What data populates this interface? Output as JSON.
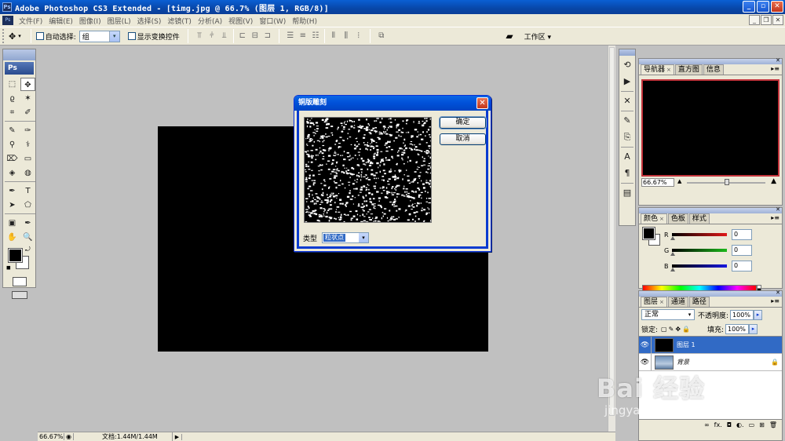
{
  "window": {
    "title": "Adobe Photoshop CS3 Extended - [timg.jpg @ 66.7% (图层 1, RGB/8)]",
    "app_icon": "Ps",
    "buttons": [
      "_",
      "▫",
      "✕"
    ]
  },
  "menu": {
    "items": [
      "文件(F)",
      "编辑(E)",
      "图像(I)",
      "图层(L)",
      "选择(S)",
      "滤镜(T)",
      "分析(A)",
      "视图(V)",
      "窗口(W)",
      "帮助(H)"
    ],
    "mdi_buttons": [
      "_",
      "❐",
      "✕"
    ]
  },
  "options": {
    "auto_select_label": "自动选择:",
    "auto_select_value": "组",
    "show_transform_label": "显示变换控件",
    "workspace_label": "工作区 ▾"
  },
  "toolbox": {
    "logo": "Ps",
    "tools": [
      "⬚",
      "✥",
      "ϱ",
      "✶",
      "⌗",
      "✐",
      "✎",
      "✑",
      "⚲",
      "⚕",
      "⌦",
      "▭",
      "◈",
      "◍",
      "✒",
      "T",
      "➤",
      "⬠",
      "▣",
      "✒",
      "✋",
      "🔍"
    ]
  },
  "document": {
    "zoom": "66.67%",
    "doc_size": "文档:1.44M/1.44M"
  },
  "dialog": {
    "title": "铜版雕刻",
    "ok_label": "确定",
    "cancel_label": "取消",
    "type_label": "类型",
    "type_value": "粒状点",
    "close_label": "✕"
  },
  "navigator": {
    "tabs": [
      "导航器",
      "直方图",
      "信息"
    ],
    "zoom": "66.67%"
  },
  "color": {
    "tabs": [
      "颜色",
      "色板",
      "样式"
    ],
    "channels": [
      {
        "label": "R",
        "value": "0",
        "color": "#cc1b1b"
      },
      {
        "label": "G",
        "value": "0",
        "color": "#1a9a1a"
      },
      {
        "label": "B",
        "value": "0",
        "color": "#1a1ab8"
      }
    ]
  },
  "layers": {
    "tabs": [
      "图层",
      "通道",
      "路径"
    ],
    "blend_mode": "正常",
    "opacity_label": "不透明度:",
    "opacity": "100%",
    "lock_label": "锁定:",
    "fill_label": "填充:",
    "fill": "100%",
    "items": [
      {
        "name": "图层 1",
        "selected": true
      },
      {
        "name": "背景",
        "selected": false
      }
    ],
    "footer_icons": [
      "∞",
      "fx.",
      "◘",
      "◐.",
      "▭",
      "⊞",
      "🗑"
    ]
  },
  "watermark": {
    "brand": "Bai 经验",
    "url": "jingyan.baidu.com"
  }
}
